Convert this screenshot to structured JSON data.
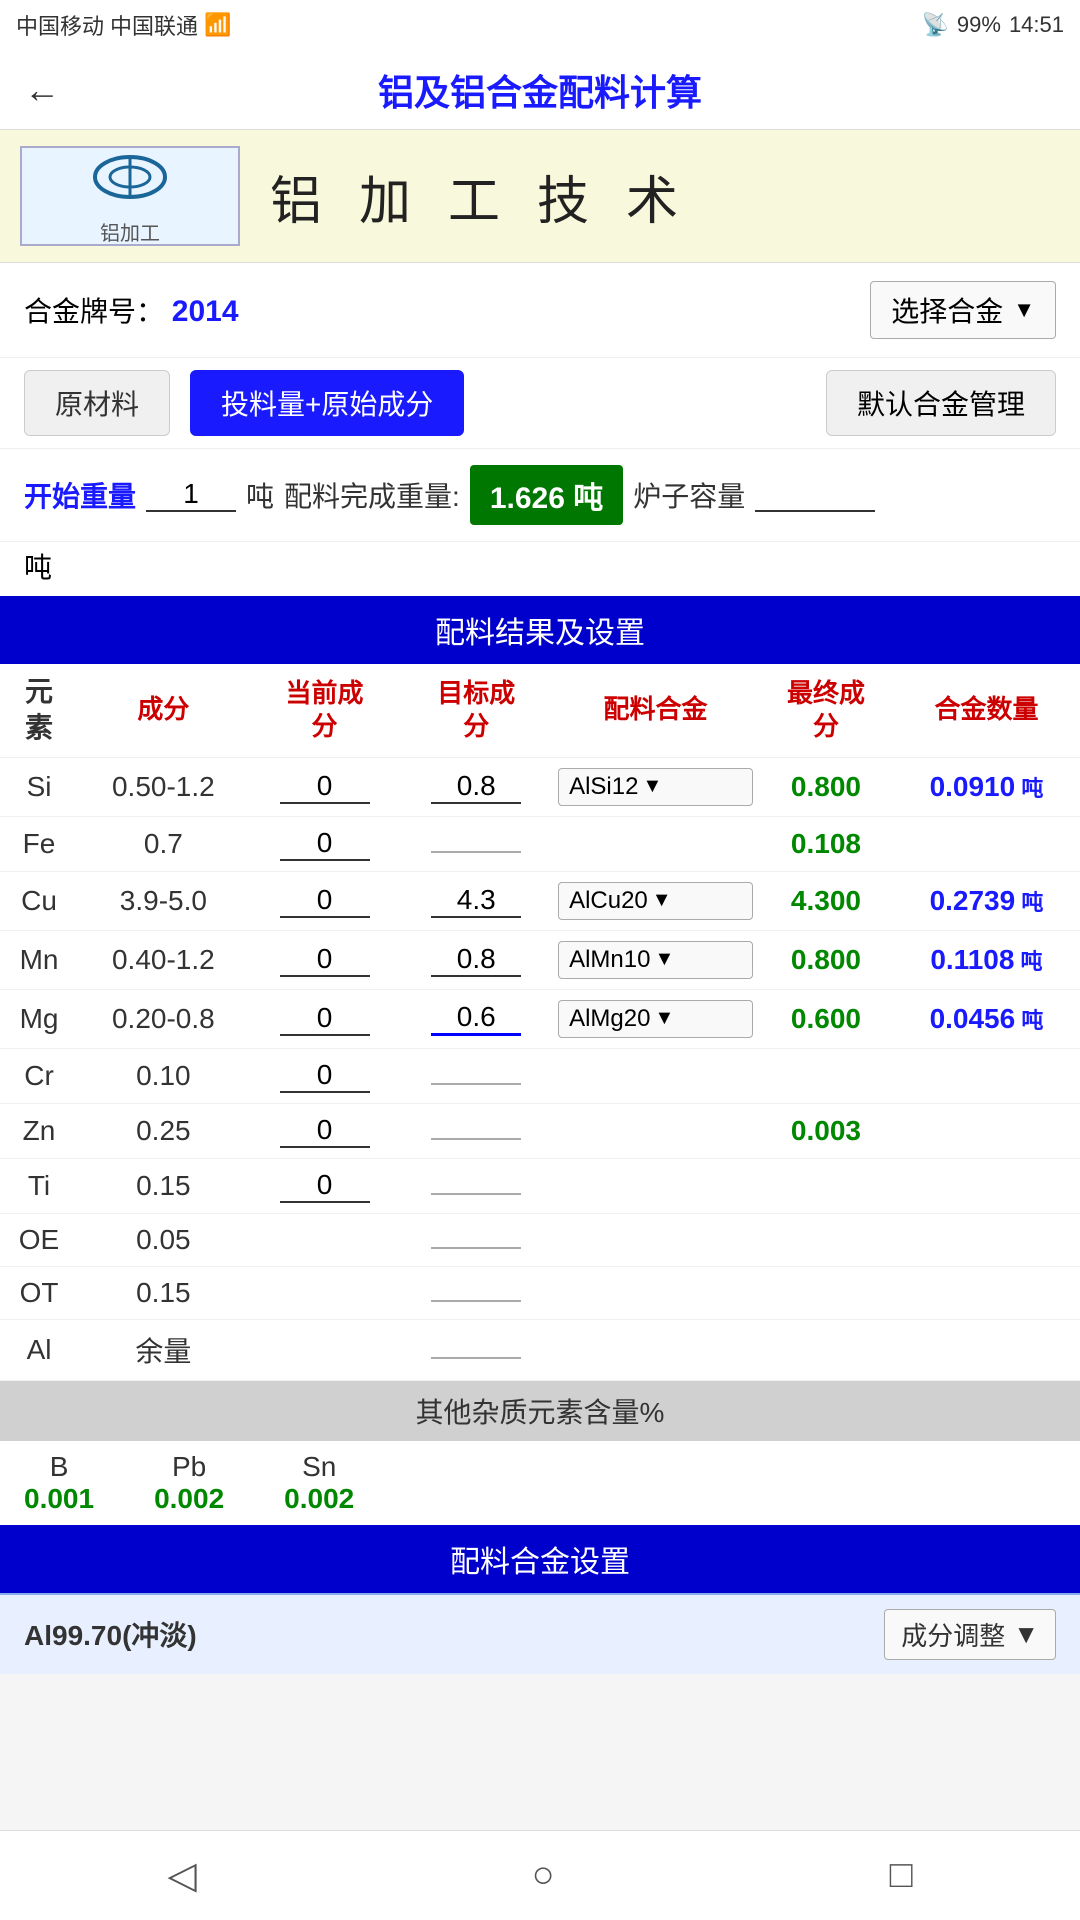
{
  "statusBar": {
    "carrier1": "中国移动",
    "carrier2": "中国联通",
    "time": "14:51",
    "battery": "99%"
  },
  "header": {
    "back": "←",
    "title": "铝及铝合金配料计算"
  },
  "logoBanner": {
    "logoText": "铝加工",
    "bannerTitle": "铝 加 工 技 术"
  },
  "alloySection": {
    "label": "合金牌号：",
    "value": "2014",
    "selectLabel": "选择合金"
  },
  "tabs": {
    "rawMaterial": "原材料",
    "batchComp": "投料量+原始成分",
    "manageBtn": "默认合金管理"
  },
  "weights": {
    "startLabel": "开始重量",
    "startValue": "1",
    "startUnit": "吨",
    "resultLabel": "配料完成重量:",
    "resultValue": "1.626 吨",
    "furnaceLabel": "炉子容量",
    "furnaceValue": "",
    "furnaceUnit": "吨"
  },
  "tableSection": {
    "header": "配料结果及设置",
    "columns": [
      "元素",
      "成分",
      "当前成分",
      "目标成分",
      "配料合金",
      "最终成分",
      "合金数量"
    ],
    "rows": [
      {
        "element": "Si",
        "range": "0.50-1.2",
        "current": "0",
        "target": "0.8",
        "alloy": "AlSi12",
        "final": "0.800",
        "qty": "0.0910",
        "qtyUnit": "吨"
      },
      {
        "element": "Fe",
        "range": "0.7",
        "current": "0",
        "target": "",
        "alloy": "",
        "final": "0.108",
        "qty": "",
        "qtyUnit": ""
      },
      {
        "element": "Cu",
        "range": "3.9-5.0",
        "current": "0",
        "target": "4.3",
        "alloy": "AlCu20",
        "final": "4.300",
        "qty": "0.2739",
        "qtyUnit": "吨"
      },
      {
        "element": "Mn",
        "range": "0.40-1.2",
        "current": "0",
        "target": "0.8",
        "alloy": "AlMn10",
        "final": "0.800",
        "qty": "0.1108",
        "qtyUnit": "吨"
      },
      {
        "element": "Mg",
        "range": "0.20-0.8",
        "current": "0",
        "target": "0.6",
        "alloy": "AlMg20",
        "final": "0.600",
        "qty": "0.0456",
        "qtyUnit": "吨"
      },
      {
        "element": "Cr",
        "range": "0.10",
        "current": "0",
        "target": "",
        "alloy": "",
        "final": "",
        "qty": "",
        "qtyUnit": ""
      },
      {
        "element": "Zn",
        "range": "0.25",
        "current": "0",
        "target": "",
        "alloy": "",
        "final": "0.003",
        "qty": "",
        "qtyUnit": ""
      },
      {
        "element": "Ti",
        "range": "0.15",
        "current": "0",
        "target": "",
        "alloy": "",
        "final": "",
        "qty": "",
        "qtyUnit": ""
      },
      {
        "element": "OE",
        "range": "0.05",
        "current": "",
        "target": "",
        "alloy": "",
        "final": "",
        "qty": "",
        "qtyUnit": ""
      },
      {
        "element": "OT",
        "range": "0.15",
        "current": "",
        "target": "",
        "alloy": "",
        "final": "",
        "qty": "",
        "qtyUnit": ""
      },
      {
        "element": "Al",
        "range": "余量",
        "current": "",
        "target": "",
        "alloy": "",
        "final": "",
        "qty": "",
        "qtyUnit": ""
      }
    ]
  },
  "impuritySection": {
    "header": "其他杂质元素含量%",
    "items": [
      {
        "label": "B",
        "value": "0.001"
      },
      {
        "label": "Pb",
        "value": "0.002"
      },
      {
        "label": "Sn",
        "value": "0.002"
      }
    ]
  },
  "alloyConfigSection": {
    "header": "配料合金设置",
    "rows": [
      {
        "name": "Al99.70(冲淡)",
        "adjustLabel": "成分调整"
      }
    ]
  },
  "bottomNav": {
    "back": "◁",
    "home": "○",
    "recent": "□"
  }
}
